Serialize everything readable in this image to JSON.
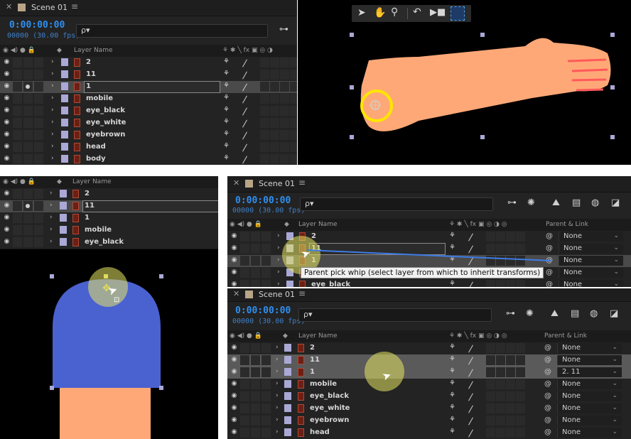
{
  "scene_name": "Scene 01",
  "timecode": "0:00:00:00",
  "fps": "00000 (30.00 fps)",
  "search_icon": "ρ▾",
  "layer_name_header": "Layer Name",
  "parent_link_header": "Parent & Link",
  "tooltip": "Parent pick whip (select layer from which to inherit transforms)",
  "panel_tl": {
    "layers": [
      "2",
      "11",
      "1",
      "mobile",
      "eye_black",
      "eye_white",
      "eyebrown",
      "head",
      "body"
    ]
  },
  "panel_ml": {
    "layers": [
      "2",
      "11",
      "1",
      "mobile",
      "eye_black"
    ]
  },
  "panel_mr": {
    "layers": [
      "2",
      "11",
      "1",
      "",
      "eye_black"
    ],
    "parents": [
      "None",
      "None",
      "None",
      "None",
      "None"
    ]
  },
  "panel_br": {
    "layers": [
      "2",
      "11",
      "1",
      "mobile",
      "eye_black",
      "eye_white",
      "eyebrown",
      "head"
    ],
    "parents": [
      "None",
      "None",
      "2. 11",
      "None",
      "None",
      "None",
      "None",
      "None"
    ]
  },
  "colors": {
    "timecode": "#2f8ff0",
    "label_lavender": "#a9a8d6",
    "arm_skin": "#ffa877",
    "arm_stripe": "#ff5a5a",
    "head_blue": "#4a61d0",
    "highlight_yellow": "#ffe600"
  },
  "icons": {
    "comp_toolbar": [
      "selection-arrow-icon",
      "hand-icon",
      "zoom-icon",
      "undo-icon",
      "camera-icon",
      "region-of-interest-icon"
    ]
  }
}
